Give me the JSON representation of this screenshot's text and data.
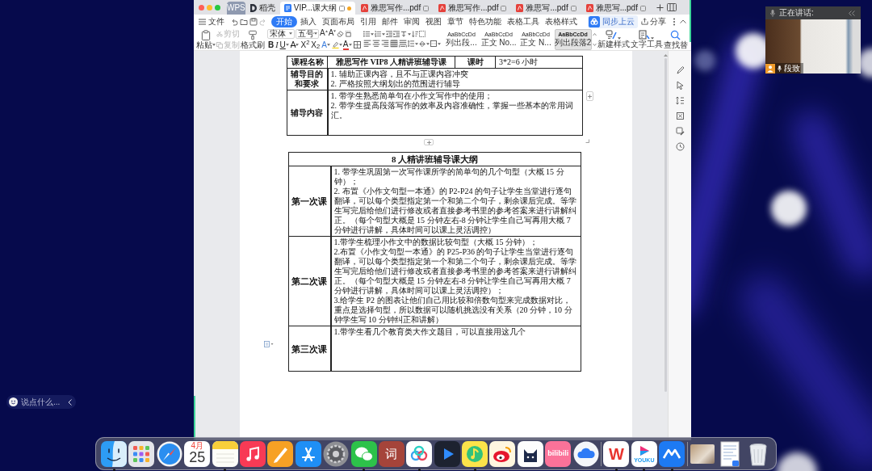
{
  "wps_window": {
    "tabs": [
      {
        "kind": "home",
        "label": "WPS",
        "selected": false
      },
      {
        "kind": "docer",
        "label": "稻壳",
        "selected": false
      },
      {
        "kind": "doc",
        "label": "VIP...课大纲",
        "selected": true,
        "modified": true
      },
      {
        "kind": "pdf",
        "label": "雅思写作...pdf",
        "selected": false,
        "modified": false
      },
      {
        "kind": "pdf",
        "label": "雅思写作...pdf",
        "selected": false,
        "modified": false
      },
      {
        "kind": "pdf",
        "label": "雅思写...pdf",
        "selected": false,
        "modified": false
      },
      {
        "kind": "pdf",
        "label": "雅思写...pdf",
        "selected": false,
        "modified": false
      }
    ],
    "file_menu": "文件",
    "menu_tabs": [
      {
        "label": "开始",
        "selected": true
      },
      {
        "label": "插入",
        "selected": false
      },
      {
        "label": "页面布局",
        "selected": false
      },
      {
        "label": "引用",
        "selected": false
      },
      {
        "label": "邮件",
        "selected": false
      },
      {
        "label": "审阅",
        "selected": false
      },
      {
        "label": "视图",
        "selected": false
      },
      {
        "label": "章节",
        "selected": false
      },
      {
        "label": "特色功能",
        "selected": false
      },
      {
        "label": "表格工具",
        "selected": false
      },
      {
        "label": "表格样式",
        "selected": false
      }
    ],
    "cloud_badge": "同步上云",
    "share": "分享",
    "ribbon": {
      "paste": "粘贴",
      "cut": {
        "label": "剪切",
        "disabled": true
      },
      "copy": {
        "label": "复制",
        "disabled": true
      },
      "format_painter": "格式刷",
      "font": "宋体",
      "font_size": "五号",
      "size_buttons": [
        {
          "kind": "grow",
          "label": "A"
        },
        {
          "kind": "shrink",
          "label": "A"
        }
      ],
      "format_buttons": [
        {
          "kind": "bold",
          "label": "B"
        },
        {
          "kind": "italic",
          "label": "I"
        },
        {
          "kind": "underline",
          "label": "U"
        },
        {
          "kind": "strike",
          "label": "A"
        },
        {
          "kind": "superscript",
          "label": "X$^{2}$"
        },
        {
          "kind": "subscript",
          "label": "X$_{2}$"
        },
        {
          "kind": "effect",
          "label": "A"
        },
        {
          "kind": "color",
          "label": "A"
        }
      ],
      "alignments": [
        {
          "kind": "left",
          "selected": false
        },
        {
          "kind": "center",
          "selected": false
        },
        {
          "kind": "right",
          "selected": false
        },
        {
          "kind": "justify",
          "selected": true
        },
        {
          "kind": "distributed",
          "selected": false
        }
      ],
      "styles": [
        {
          "sample": "AaBbCcDd",
          "label": "列出段...",
          "selected": false
        },
        {
          "sample": "AaBbCcDd",
          "label": "正文 No...",
          "selected": false
        },
        {
          "sample": "AaBbCcDd",
          "label": "正文 N...",
          "selected": false
        },
        {
          "sample": "AaBbCcDd",
          "label": "列出段落2",
          "selected": true
        }
      ],
      "new_style": "新建样式",
      "text_tools": "文字工具",
      "find_replace": "查找替"
    }
  },
  "document": {
    "info_table": {
      "course_label": "课程名称",
      "course": "雅思写作 VIP8 人精讲班辅导课",
      "hours_label": "课时",
      "hours": "3*2=6 小时",
      "goals_label": "辅导目的和要求",
      "goals": [
        "1. 辅助正课内容，且不与正课内容冲突",
        "2. 严格按照大纲划出的范围进行辅导"
      ],
      "content_label": "辅导内容",
      "content": [
        "1. 带学生熟悉简单句在小作文写作中的使用；",
        "2. 带学生提高段落写作的效率及内容准确性，掌握一些基本的常用词汇。"
      ]
    },
    "outline_table": {
      "title": "8 人精讲班辅导课大纲",
      "sessions": [
        {
          "label": "第一次课",
          "items": [
            "1. 带学生巩固第一次写作课所学的简单句的几个句型（大概 15 分钟）；",
            "2. 布置《小作文句型一本通》的 P2-P24 的句子让学生当堂进行逐句翻译，可以每个类型指定第一个和第二个句子，剩余课后完成。等学生写完后给他们进行修改或者直接参考书里的参考答案来进行讲解纠正。（每个句型大概是 15 分钟左右-8 分钟让学生自己写再用大概 7 分钟进行讲解，具体时间可以课上灵活调控）"
          ]
        },
        {
          "label": "第二次课",
          "items": [
            "1.带学生梳理小作文中的数据比较句型（大概 15 分钟）；",
            "2.布置《小作文句型一本通》的 P25-P36 的句子让学生当堂进行逐句翻译，可以每个类型指定第一个和第二个句子，剩余课后完成。等学生写完后给他们进行修改或者直接参考书里的参考答案来进行讲解纠正。（每个句型大概是 15 分钟左右-8 分钟让学生自己写再用大概 7 分钟进行讲解，具体时间可以课上灵活调控）；",
            "3.给学生 P2 的图表让他们自己用比较和倍数句型来完成数据对比，重点是选择句型，所以数据可以随机挑选没有关系（20 分钟，10 分钟学生写 10 分钟纠正和讲解）"
          ]
        },
        {
          "label": "第三次课",
          "items": [
            "1.带学生看几个教育类大作文题目，可以直接用这几个"
          ]
        }
      ]
    }
  },
  "video_call": {
    "status": "正在讲话:",
    "speaker": "段致"
  },
  "chat_input": {
    "placeholder": "说点什么..."
  },
  "dock": {
    "apps": [
      {
        "kind": "finder",
        "running": true
      },
      {
        "kind": "launchpad",
        "running": false
      },
      {
        "kind": "safari",
        "running": false
      },
      {
        "kind": "calendar",
        "month": "4月",
        "day": "25",
        "running": false
      },
      {
        "kind": "notes",
        "running": true
      },
      {
        "kind": "music",
        "running": false
      },
      {
        "kind": "pages",
        "running": false
      },
      {
        "kind": "appstore",
        "running": false
      },
      {
        "kind": "settings",
        "running": false
      },
      {
        "kind": "wechat",
        "running": true
      },
      {
        "kind": "dictionary",
        "label": "词",
        "running": false
      },
      {
        "kind": "netdisk",
        "running": true
      },
      {
        "kind": "video",
        "running": false
      },
      {
        "kind": "qqmusic",
        "running": true
      },
      {
        "kind": "weibo",
        "running": false
      },
      {
        "kind": "cat",
        "running": false
      },
      {
        "kind": "bilibili",
        "label": "bilibili",
        "running": false
      },
      {
        "kind": "cloud",
        "running": false
      },
      {
        "kind": "separator"
      },
      {
        "kind": "wps",
        "label": "W",
        "running": true
      },
      {
        "kind": "youku",
        "label": "YOUKU",
        "running": true
      },
      {
        "kind": "lark",
        "running": true
      },
      {
        "kind": "separator"
      },
      {
        "kind": "photo"
      },
      {
        "kind": "document"
      },
      {
        "kind": "trash"
      }
    ]
  }
}
